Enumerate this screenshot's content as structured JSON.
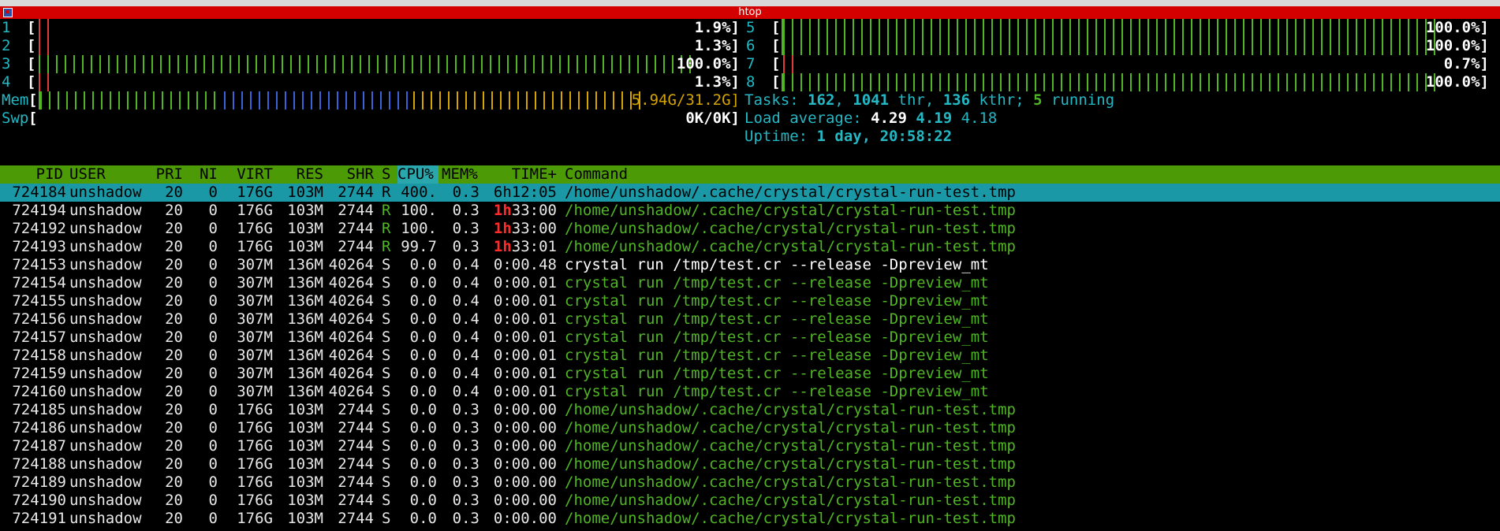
{
  "window": {
    "title": "htop"
  },
  "cpus": [
    {
      "id": "1",
      "value": "1.9%]",
      "fill": 0.019
    },
    {
      "id": "2",
      "value": "1.3%]",
      "fill": 0.013
    },
    {
      "id": "3",
      "value": "100.0%]",
      "fill": 1.0
    },
    {
      "id": "4",
      "value": "1.3%]",
      "fill": 0.013
    },
    {
      "id": "5",
      "value": "100.0%]",
      "fill": 1.0
    },
    {
      "id": "6",
      "value": "100.0%]",
      "fill": 1.0
    },
    {
      "id": "7",
      "value": "0.7%]",
      "fill": 0.007
    },
    {
      "id": "8",
      "value": "100.0%]",
      "fill": 1.0
    }
  ],
  "mem": {
    "label": "Mem",
    "value": "5.94G/31.2G]",
    "used_fraction": 0.19
  },
  "swp": {
    "label": "Swp",
    "value": "0K/0K]",
    "used_fraction": 0.0
  },
  "tasks": {
    "label": "Tasks: ",
    "count": "162",
    "thr_sep": ", ",
    "threads": "1041",
    "thr_label": " thr, ",
    "kthreads": "136",
    "kthr_label": " kthr; ",
    "running": "5",
    "running_label": " running"
  },
  "load": {
    "label": "Load average: ",
    "one": "4.29",
    "five": "4.19",
    "fifteen": "4.18"
  },
  "uptime": {
    "label": "Uptime: ",
    "value": "1 day, 20:58:22"
  },
  "columns": {
    "pid": "PID",
    "user": "USER",
    "pri": "PRI",
    "ni": "NI",
    "virt": "VIRT",
    "res": "RES",
    "shr": "SHR",
    "s": "S",
    "cpu": "CPU%",
    "mem": "MEM%",
    "time": "TIME+",
    "command": "Command"
  },
  "processes": [
    {
      "pid": "724184",
      "user": "unshadow",
      "pri": "20",
      "ni": "0",
      "virt": "176G",
      "res": "103M",
      "shr": "2744",
      "s": "R",
      "cpu": "400.",
      "mem": "0.3",
      "time_h": "",
      "time": "6h12:05",
      "command": "/home/unshadow/.cache/crystal/crystal-run-test.tmp"
    },
    {
      "pid": "724194",
      "user": "unshadow",
      "pri": "20",
      "ni": "0",
      "virt": "176G",
      "res": "103M",
      "shr": "2744",
      "s": "R",
      "cpu": "100.",
      "mem": "0.3",
      "time_h": "1h",
      "time": "33:00",
      "command": "/home/unshadow/.cache/crystal/crystal-run-test.tmp"
    },
    {
      "pid": "724192",
      "user": "unshadow",
      "pri": "20",
      "ni": "0",
      "virt": "176G",
      "res": "103M",
      "shr": "2744",
      "s": "R",
      "cpu": "100.",
      "mem": "0.3",
      "time_h": "1h",
      "time": "33:00",
      "command": "/home/unshadow/.cache/crystal/crystal-run-test.tmp"
    },
    {
      "pid": "724193",
      "user": "unshadow",
      "pri": "20",
      "ni": "0",
      "virt": "176G",
      "res": "103M",
      "shr": "2744",
      "s": "R",
      "cpu": "99.7",
      "mem": "0.3",
      "time_h": "1h",
      "time": "33:01",
      "command": "/home/unshadow/.cache/crystal/crystal-run-test.tmp"
    },
    {
      "pid": "724153",
      "user": "unshadow",
      "pri": "20",
      "ni": "0",
      "virt": "307M",
      "res": "136M",
      "shr": "40264",
      "s": "S",
      "cpu": "0.0",
      "mem": "0.4",
      "time_h": "",
      "time": "0:00.48",
      "command": "crystal run /tmp/test.cr --release -Dpreview_mt"
    },
    {
      "pid": "724154",
      "user": "unshadow",
      "pri": "20",
      "ni": "0",
      "virt": "307M",
      "res": "136M",
      "shr": "40264",
      "s": "S",
      "cpu": "0.0",
      "mem": "0.4",
      "time_h": "",
      "time": "0:00.01",
      "command": "crystal run /tmp/test.cr --release -Dpreview_mt"
    },
    {
      "pid": "724155",
      "user": "unshadow",
      "pri": "20",
      "ni": "0",
      "virt": "307M",
      "res": "136M",
      "shr": "40264",
      "s": "S",
      "cpu": "0.0",
      "mem": "0.4",
      "time_h": "",
      "time": "0:00.01",
      "command": "crystal run /tmp/test.cr --release -Dpreview_mt"
    },
    {
      "pid": "724156",
      "user": "unshadow",
      "pri": "20",
      "ni": "0",
      "virt": "307M",
      "res": "136M",
      "shr": "40264",
      "s": "S",
      "cpu": "0.0",
      "mem": "0.4",
      "time_h": "",
      "time": "0:00.01",
      "command": "crystal run /tmp/test.cr --release -Dpreview_mt"
    },
    {
      "pid": "724157",
      "user": "unshadow",
      "pri": "20",
      "ni": "0",
      "virt": "307M",
      "res": "136M",
      "shr": "40264",
      "s": "S",
      "cpu": "0.0",
      "mem": "0.4",
      "time_h": "",
      "time": "0:00.01",
      "command": "crystal run /tmp/test.cr --release -Dpreview_mt"
    },
    {
      "pid": "724158",
      "user": "unshadow",
      "pri": "20",
      "ni": "0",
      "virt": "307M",
      "res": "136M",
      "shr": "40264",
      "s": "S",
      "cpu": "0.0",
      "mem": "0.4",
      "time_h": "",
      "time": "0:00.01",
      "command": "crystal run /tmp/test.cr --release -Dpreview_mt"
    },
    {
      "pid": "724159",
      "user": "unshadow",
      "pri": "20",
      "ni": "0",
      "virt": "307M",
      "res": "136M",
      "shr": "40264",
      "s": "S",
      "cpu": "0.0",
      "mem": "0.4",
      "time_h": "",
      "time": "0:00.01",
      "command": "crystal run /tmp/test.cr --release -Dpreview_mt"
    },
    {
      "pid": "724160",
      "user": "unshadow",
      "pri": "20",
      "ni": "0",
      "virt": "307M",
      "res": "136M",
      "shr": "40264",
      "s": "S",
      "cpu": "0.0",
      "mem": "0.4",
      "time_h": "",
      "time": "0:00.01",
      "command": "crystal run /tmp/test.cr --release -Dpreview_mt"
    },
    {
      "pid": "724185",
      "user": "unshadow",
      "pri": "20",
      "ni": "0",
      "virt": "176G",
      "res": "103M",
      "shr": "2744",
      "s": "S",
      "cpu": "0.0",
      "mem": "0.3",
      "time_h": "",
      "time": "0:00.00",
      "command": "/home/unshadow/.cache/crystal/crystal-run-test.tmp"
    },
    {
      "pid": "724186",
      "user": "unshadow",
      "pri": "20",
      "ni": "0",
      "virt": "176G",
      "res": "103M",
      "shr": "2744",
      "s": "S",
      "cpu": "0.0",
      "mem": "0.3",
      "time_h": "",
      "time": "0:00.00",
      "command": "/home/unshadow/.cache/crystal/crystal-run-test.tmp"
    },
    {
      "pid": "724187",
      "user": "unshadow",
      "pri": "20",
      "ni": "0",
      "virt": "176G",
      "res": "103M",
      "shr": "2744",
      "s": "S",
      "cpu": "0.0",
      "mem": "0.3",
      "time_h": "",
      "time": "0:00.00",
      "command": "/home/unshadow/.cache/crystal/crystal-run-test.tmp"
    },
    {
      "pid": "724188",
      "user": "unshadow",
      "pri": "20",
      "ni": "0",
      "virt": "176G",
      "res": "103M",
      "shr": "2744",
      "s": "S",
      "cpu": "0.0",
      "mem": "0.3",
      "time_h": "",
      "time": "0:00.00",
      "command": "/home/unshadow/.cache/crystal/crystal-run-test.tmp"
    },
    {
      "pid": "724189",
      "user": "unshadow",
      "pri": "20",
      "ni": "0",
      "virt": "176G",
      "res": "103M",
      "shr": "2744",
      "s": "S",
      "cpu": "0.0",
      "mem": "0.3",
      "time_h": "",
      "time": "0:00.00",
      "command": "/home/unshadow/.cache/crystal/crystal-run-test.tmp"
    },
    {
      "pid": "724190",
      "user": "unshadow",
      "pri": "20",
      "ni": "0",
      "virt": "176G",
      "res": "103M",
      "shr": "2744",
      "s": "S",
      "cpu": "0.0",
      "mem": "0.3",
      "time_h": "",
      "time": "0:00.00",
      "command": "/home/unshadow/.cache/crystal/crystal-run-test.tmp"
    },
    {
      "pid": "724191",
      "user": "unshadow",
      "pri": "20",
      "ni": "0",
      "virt": "176G",
      "res": "103M",
      "shr": "2744",
      "s": "S",
      "cpu": "0.0",
      "mem": "0.3",
      "time_h": "",
      "time": "0:00.00",
      "command": "/home/unshadow/.cache/crystal/crystal-run-test.tmp"
    }
  ],
  "selected_index": 0,
  "colors": {
    "titlebar": "#d40000",
    "header": "#4c9a06",
    "sorted_column": "#2aa7ac",
    "selected_row": "#1b98a6",
    "meter_green": "#4fb523",
    "meter_red": "#e03b3b",
    "meter_blue": "#3a63d8",
    "meter_yellow": "#d6a400",
    "label_teal": "#22b8c4"
  }
}
